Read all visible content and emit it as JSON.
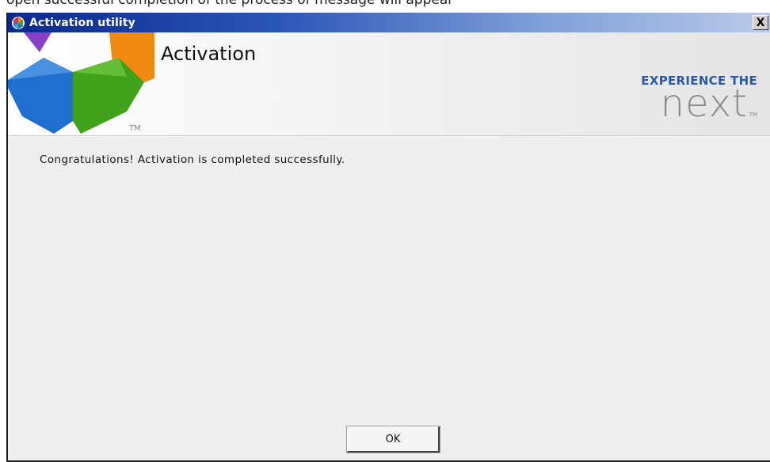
{
  "page_caption": "open successful completion of the process of message will appear",
  "window": {
    "title": "Activation utility",
    "close_label": "X"
  },
  "header": {
    "title": "Activation",
    "logo_tm": "TM",
    "brand_tagline": "EXPERIENCE THE",
    "brand_word": "next",
    "brand_tm": "TM"
  },
  "main": {
    "message": "Congratulations! Activation is completed successfully."
  },
  "footer": {
    "ok_label": "OK"
  },
  "colors": {
    "titlebar": "#0a2a8c",
    "brand_blue": "#2a5aa6",
    "logo_blue": "#1e6fd0",
    "logo_green": "#3fa21a",
    "logo_orange": "#f08a10",
    "logo_purple": "#8a3fc8"
  }
}
